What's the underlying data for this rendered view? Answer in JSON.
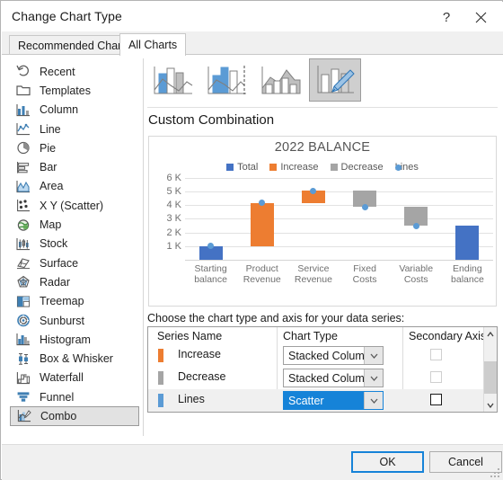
{
  "window": {
    "title": "Change Chart Type",
    "help_label": "?",
    "close_label": "✕"
  },
  "tabs": [
    {
      "label": "Recommended Charts",
      "active": false
    },
    {
      "label": "All Charts",
      "active": true
    }
  ],
  "sidebar": {
    "items": [
      {
        "label": "Recent",
        "icon": "recent-icon",
        "selected": false
      },
      {
        "label": "Templates",
        "icon": "templates-icon",
        "selected": false
      },
      {
        "label": "Column",
        "icon": "column-icon",
        "selected": false
      },
      {
        "label": "Line",
        "icon": "line-icon",
        "selected": false
      },
      {
        "label": "Pie",
        "icon": "pie-icon",
        "selected": false
      },
      {
        "label": "Bar",
        "icon": "bar-icon",
        "selected": false
      },
      {
        "label": "Area",
        "icon": "area-icon",
        "selected": false
      },
      {
        "label": "X Y (Scatter)",
        "icon": "scatter-icon",
        "selected": false
      },
      {
        "label": "Map",
        "icon": "map-icon",
        "selected": false
      },
      {
        "label": "Stock",
        "icon": "stock-icon",
        "selected": false
      },
      {
        "label": "Surface",
        "icon": "surface-icon",
        "selected": false
      },
      {
        "label": "Radar",
        "icon": "radar-icon",
        "selected": false
      },
      {
        "label": "Treemap",
        "icon": "treemap-icon",
        "selected": false
      },
      {
        "label": "Sunburst",
        "icon": "sunburst-icon",
        "selected": false
      },
      {
        "label": "Histogram",
        "icon": "histogram-icon",
        "selected": false
      },
      {
        "label": "Box & Whisker",
        "icon": "box-whisker-icon",
        "selected": false
      },
      {
        "label": "Waterfall",
        "icon": "waterfall-icon",
        "selected": false
      },
      {
        "label": "Funnel",
        "icon": "funnel-icon",
        "selected": false
      },
      {
        "label": "Combo",
        "icon": "combo-icon",
        "selected": true
      }
    ]
  },
  "combo_types": [
    {
      "name": "clustered-column-line",
      "selected": false
    },
    {
      "name": "clustered-column-line-secondary",
      "selected": false
    },
    {
      "name": "stacked-area-clustered-column",
      "selected": false
    },
    {
      "name": "custom-combination",
      "selected": true
    }
  ],
  "section": {
    "title": "Custom Combination"
  },
  "chart_data": {
    "type": "bar",
    "title": "2022 BALANCE",
    "xlabel": "",
    "ylabel": "",
    "ylim": [
      0,
      6000
    ],
    "ytick_values": [
      6000,
      5000,
      4000,
      3000,
      2000,
      1000
    ],
    "ytick_labels": [
      "6 K",
      "5 K",
      "4 K",
      "3 K",
      "2 K",
      "1 K"
    ],
    "grid": true,
    "legend_position": "top",
    "legend": [
      {
        "name": "Total",
        "color": "#4472c4",
        "marker": "square"
      },
      {
        "name": "Increase",
        "color": "#ed7d31",
        "marker": "square"
      },
      {
        "name": "Decrease",
        "color": "#a5a5a5",
        "marker": "square"
      },
      {
        "name": "Lines",
        "color": "#5b9bd5",
        "marker": "circle"
      }
    ],
    "categories": [
      "Starting balance",
      "Product Revenue",
      "Service Revenue",
      "Fixed Costs",
      "Variable Costs",
      "Ending balance"
    ],
    "category_lines": [
      [
        "Starting",
        "balance"
      ],
      [
        "Product",
        "Revenue"
      ],
      [
        "Service",
        "Revenue"
      ],
      [
        "Fixed",
        "Costs"
      ],
      [
        "Variable",
        "Costs"
      ],
      [
        "Ending",
        "balance"
      ]
    ],
    "bars": [
      {
        "category": "Starting balance",
        "series": "Total",
        "base": 0,
        "top": 1000,
        "color": "#4472c4"
      },
      {
        "category": "Product Revenue",
        "series": "Increase",
        "base": 1000,
        "top": 4150,
        "color": "#ed7d31"
      },
      {
        "category": "Service Revenue",
        "series": "Increase",
        "base": 4150,
        "top": 5050,
        "color": "#ed7d31"
      },
      {
        "category": "Fixed Costs",
        "series": "Decrease",
        "base": 3850,
        "top": 5050,
        "color": "#a5a5a5"
      },
      {
        "category": "Variable Costs",
        "series": "Decrease",
        "base": 2500,
        "top": 3850,
        "color": "#a5a5a5"
      },
      {
        "category": "Ending balance",
        "series": "Total",
        "base": 0,
        "top": 2500,
        "color": "#4472c4"
      }
    ],
    "series": [
      {
        "name": "Lines",
        "type": "scatter",
        "color": "#5b9bd5",
        "values": [
          1000,
          4150,
          5050,
          3850,
          2500,
          null
        ]
      }
    ]
  },
  "series_table": {
    "caption": "Choose the chart type and axis for your data series:",
    "columns": [
      "Series Name",
      "Chart Type",
      "Secondary Axis"
    ],
    "rows": [
      {
        "name": "Increase",
        "color": "#ed7d31",
        "chart_type": "Stacked Column",
        "secondary_axis": false,
        "selected": false
      },
      {
        "name": "Decrease",
        "color": "#a5a5a5",
        "chart_type": "Stacked Column",
        "secondary_axis": false,
        "selected": false
      },
      {
        "name": "Lines",
        "color": "#5b9bd5",
        "chart_type": "Scatter",
        "secondary_axis": false,
        "selected": true
      }
    ]
  },
  "footer": {
    "ok_label": "OK",
    "cancel_label": "Cancel"
  }
}
